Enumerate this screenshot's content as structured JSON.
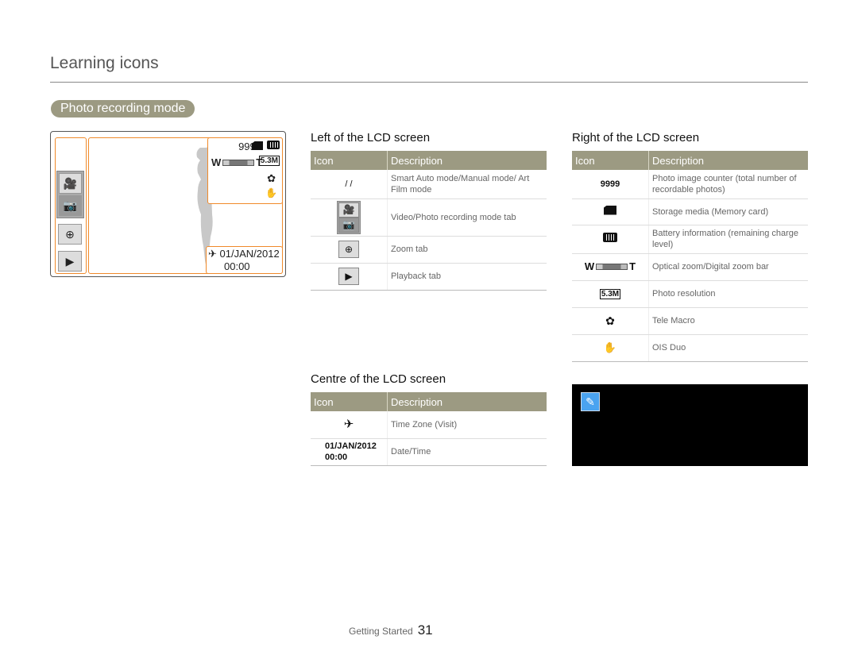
{
  "page": {
    "title": "Learning icons",
    "section": "Photo recording mode"
  },
  "lcd": {
    "counter": "9999",
    "date": "01/JAN/2012",
    "time": "00:00",
    "icons": {
      "video_mode": "video-camera-icon",
      "photo_mode": "camera-icon",
      "zoom": "zoom-in-icon",
      "playback": "play-icon",
      "storage": "memory-card-icon",
      "battery": "battery-icon",
      "zoom_bar": "zoom-bar-icon",
      "resolution": "resolution-icon",
      "macro": "tele-macro-icon",
      "ois": "ois-duo-icon",
      "timezone": "time-zone-visit-icon"
    },
    "zoom_w": "W",
    "zoom_t": "T",
    "resolution_label": "5.3M",
    "macro_glyph": "✿",
    "ois_glyph": "✋",
    "timezone_glyph": "✈"
  },
  "left_table": {
    "heading": "Left of the LCD screen",
    "col_icon": "Icon",
    "col_desc": "Description",
    "rows": [
      {
        "icon": "/      /",
        "desc": "Smart Auto mode/Manual mode/ Art Film mode"
      },
      {
        "icon": "video-photo-tab-icon",
        "desc": "Video/Photo recording mode tab"
      },
      {
        "icon": "zoom-tab-icon",
        "desc": "Zoom tab"
      },
      {
        "icon": "playback-tab-icon",
        "desc": "Playback tab"
      }
    ]
  },
  "right_table": {
    "heading": "Right of the LCD screen",
    "col_icon": "Icon",
    "col_desc": "Description",
    "rows": [
      {
        "icon": "9999",
        "desc": "Photo image counter (total number of recordable photos)"
      },
      {
        "icon": "memory-card-icon",
        "desc": "Storage media (Memory card)"
      },
      {
        "icon": "battery-icon",
        "desc": "Battery information (remaining charge level)"
      },
      {
        "icon": "zoom-bar-icon",
        "desc": "Optical zoom/Digital zoom bar"
      },
      {
        "icon": "resolution-icon",
        "desc": "Photo resolution"
      },
      {
        "icon": "tele-macro-icon",
        "desc": "Tele Macro"
      },
      {
        "icon": "ois-duo-icon",
        "desc": "OIS Duo"
      }
    ]
  },
  "centre_table": {
    "heading": "Centre of the LCD screen",
    "col_icon": "Icon",
    "col_desc": "Description",
    "rows": [
      {
        "icon": "time-zone-visit-icon",
        "desc": "Time Zone (Visit)"
      },
      {
        "icon": "01/JAN/2012 00:00",
        "date": "01/JAN/2012",
        "time": "00:00",
        "desc": "Date/Time"
      }
    ]
  },
  "note": {
    "icon": "note-pencil-icon"
  },
  "footer": {
    "section": "Getting Started",
    "page_number": "31"
  },
  "colors": {
    "accent": "#9c9a82",
    "lcd_frame": "#f08a2a",
    "note_icon": "#4aa3f0"
  }
}
